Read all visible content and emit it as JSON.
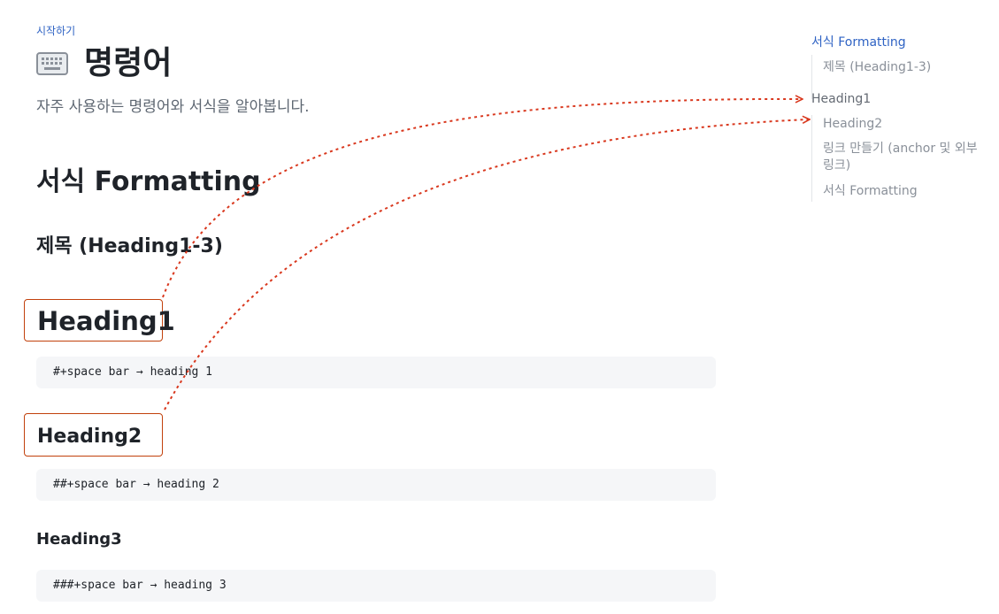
{
  "breadcrumb": "시작하기",
  "page": {
    "icon": "keyboard-icon",
    "title": "명령어",
    "description": "자주 사용하는 명령어와 서식을 알아봅니다."
  },
  "content": {
    "section_title": "서식 Formatting",
    "sub_title": "제목 (Heading1-3)",
    "heading1": "Heading1",
    "heading1_code": "#+space bar → heading 1",
    "heading2": "Heading2",
    "heading2_code": "##+space bar → heading 2",
    "heading3": "Heading3",
    "heading3_code": "###+space bar → heading 3"
  },
  "toc": {
    "items": [
      {
        "label": "서식 Formatting",
        "level": 1,
        "active": true
      },
      {
        "label": "제목 (Heading1-3)",
        "level": 2
      },
      {
        "label": "Heading1",
        "level": 1
      },
      {
        "label": "Heading2",
        "level": 2
      },
      {
        "label": "링크 만들기 (anchor 및 외부",
        "level": 2
      },
      {
        "label": "링크)",
        "level": 2
      },
      {
        "label": "서식 Formatting",
        "level": 2
      }
    ]
  },
  "colors": {
    "accent": "#2f63c4",
    "annotation": "#c2410c",
    "arrow": "#d9381e",
    "code_bg": "#f5f6f8"
  }
}
